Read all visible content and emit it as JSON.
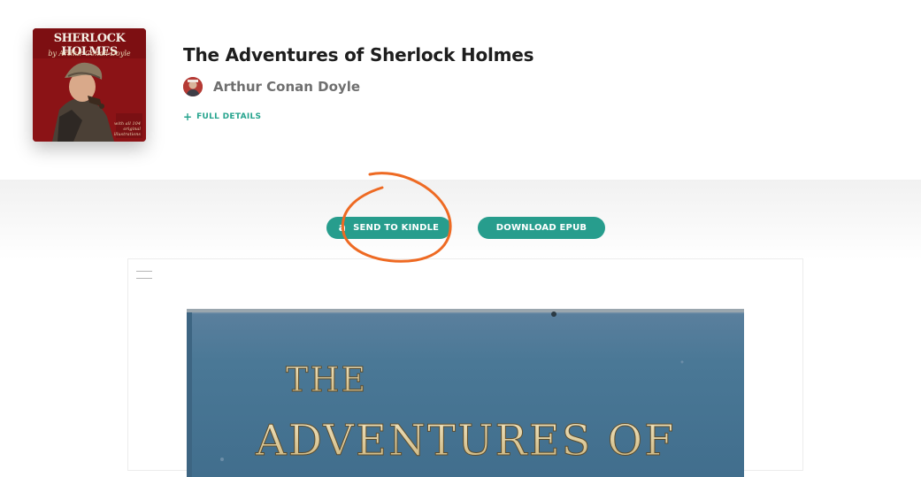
{
  "book": {
    "title": "The Adventures of Sherlock Holmes",
    "author": "Arthur Conan Doyle",
    "full_details_label": "FULL DETAILS",
    "cover_thumb": {
      "title": "SHERLOCK HOLMES",
      "author_line": "by Arthur Conan Doyle",
      "note": "with all 104 original illustrations"
    }
  },
  "actions": {
    "send_to_kindle": "SEND TO KINDLE",
    "download_epub": "DOWNLOAD EPUB",
    "amazon_icon_glyph": "a"
  },
  "reader": {
    "cover_line_1": "THE",
    "cover_line_2": "ADVENTURES OF"
  },
  "colors": {
    "accent": "#279d8d",
    "annotation": "#ee6a23"
  },
  "icons": {
    "details": "plus-icon",
    "kindle": "amazon-icon",
    "reader_menu": "hamburger-menu-icon"
  }
}
